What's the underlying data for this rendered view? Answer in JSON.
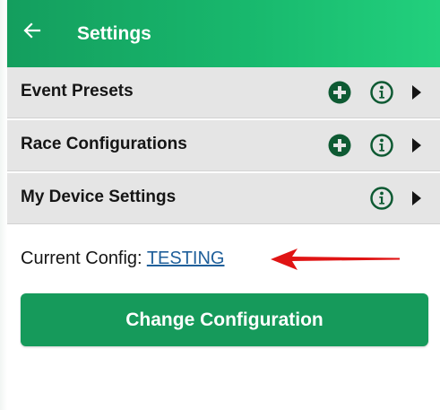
{
  "appbar": {
    "title": "Settings",
    "back_icon": "arrow-left-icon"
  },
  "rows": [
    {
      "label": "Event Presets",
      "has_add": true,
      "add_icon": "plus-circle-icon",
      "info_icon": "info-circle-icon",
      "chevron_icon": "caret-right-icon"
    },
    {
      "label": "Race Configurations",
      "has_add": true,
      "add_icon": "plus-circle-icon",
      "info_icon": "info-circle-icon",
      "chevron_icon": "caret-right-icon"
    },
    {
      "label": "My Device Settings",
      "has_add": false,
      "info_icon": "info-circle-icon",
      "chevron_icon": "caret-right-icon"
    }
  ],
  "current_config": {
    "label": "Current Config: ",
    "value": "TESTING",
    "annotation_icon": "red-arrow-annotation"
  },
  "change_button": {
    "label": "Change Configuration"
  },
  "colors": {
    "appbar_start": "#149e5e",
    "appbar_end": "#22d07d",
    "row_bg": "#e5e5e5",
    "icon_green": "#0e5a33",
    "link_blue": "#1f5f9a",
    "button_green": "#169a5b",
    "annotation_red": "#e01414"
  }
}
